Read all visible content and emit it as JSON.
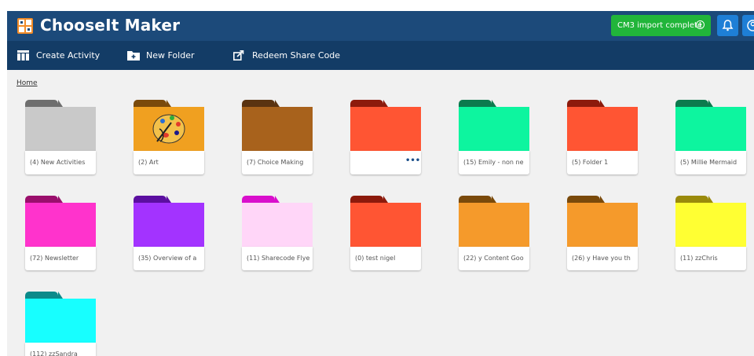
{
  "header": {
    "app_title": "ChooseIt Maker",
    "import_status": "CM3 import complete"
  },
  "toolbar": {
    "create_activity": "Create Activity",
    "new_folder": "New Folder",
    "redeem_share_code": "Redeem Share Code"
  },
  "breadcrumb": {
    "home": "Home"
  },
  "folders": [
    {
      "label": "(4) New Activities",
      "tab": "#6e6e6e",
      "body": "#c9c9c9"
    },
    {
      "label": "(2) Art",
      "tab": "#7a4a0b",
      "body": "#f0a020",
      "image": "art-palette"
    },
    {
      "label": "(7) Choice Making",
      "tab": "#5a3311",
      "body": "#a8621c"
    },
    {
      "label": "",
      "tab": "#8c1a0c",
      "body": "#ff5533",
      "menu": "•••"
    },
    {
      "label": "(15) Emily - non ne",
      "tab": "#0c7a4e",
      "body": "#0df59f"
    },
    {
      "label": "(5) Folder 1",
      "tab": "#8c1a0c",
      "body": "#ff5533"
    },
    {
      "label": "(5) Millie Mermaid",
      "tab": "#0c7a4e",
      "body": "#0df59f"
    },
    {
      "label": "(72) Newsletter",
      "tab": "#9a0f6c",
      "body": "#ff33cc"
    },
    {
      "label": "(35) Overview of a",
      "tab": "#5b0fa0",
      "body": "#a333ff"
    },
    {
      "label": "(11) Sharecode Flye",
      "tab": "#d90fcc",
      "body": "#ffd6f8"
    },
    {
      "label": "(0) test nigel",
      "tab": "#8c1a0c",
      "body": "#ff5533"
    },
    {
      "label": "(22) y Content Goo",
      "tab": "#7a4a0b",
      "body": "#f59a2b"
    },
    {
      "label": "(26) y Have you th",
      "tab": "#7a4a0b",
      "body": "#f59a2b"
    },
    {
      "label": "(11) zzChris",
      "tab": "#9a8a0c",
      "body": "#ffff33"
    },
    {
      "label": "(112) zzSandra",
      "tab": "#0c8a8a",
      "body": "#17ffff"
    }
  ]
}
